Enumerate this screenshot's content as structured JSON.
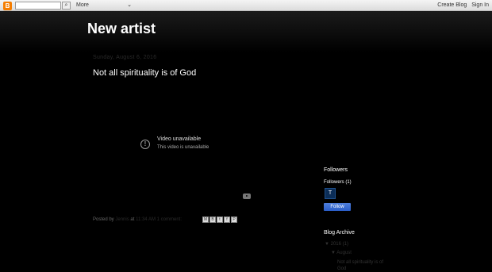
{
  "navbar": {
    "logo_glyph": "B",
    "search_button_glyph": "⌕",
    "more_label": "More",
    "caret_glyph": "⌄",
    "create_blog_label": "Create Blog",
    "sign_in_label": "Sign In"
  },
  "blog": {
    "title": "New artist"
  },
  "post": {
    "date_header": "Sunday, August 6, 2016",
    "title": "Not all spirituality is of God",
    "video": {
      "error_glyph": "!",
      "unavailable_title": "Video unavailable",
      "unavailable_sub": "This video is unavailable"
    },
    "footer": {
      "posted_by_label": "Posted by",
      "author": "Jennis",
      "at_label": "at",
      "time": "11:34 AM",
      "comments": "1 comment:"
    },
    "share_icons": [
      {
        "name": "email-share-icon",
        "glyph": "M"
      },
      {
        "name": "blogthis-share-icon",
        "glyph": "B"
      },
      {
        "name": "twitter-share-icon",
        "glyph": "t"
      },
      {
        "name": "facebook-share-icon",
        "glyph": "f"
      },
      {
        "name": "pinterest-share-icon",
        "glyph": "P"
      }
    ]
  },
  "sidebar": {
    "followers_heading": "Followers",
    "followers_count_label": "Followers (1)",
    "follower_initial": "T",
    "follow_button_label": "Follow",
    "archive_heading": "Blog Archive",
    "archive_year": "▼  2016 (1)",
    "archive_month": "▼  August",
    "archive_post": "Not all spirituality is of God"
  },
  "colors": {
    "background": "#000000",
    "follow_button": "#3b6fd6",
    "avatar": "#0b2d57"
  }
}
